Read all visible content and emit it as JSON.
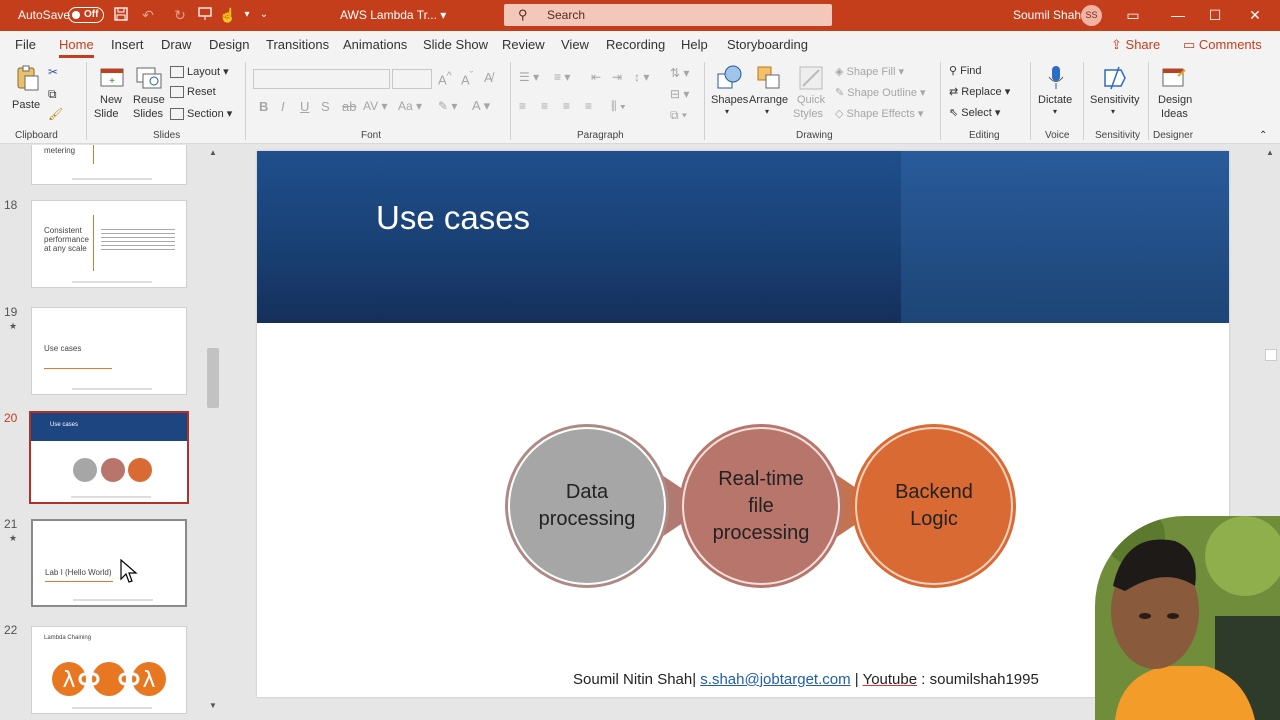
{
  "titlebar": {
    "autosave_label": "AutoSave",
    "autosave_state": "Off",
    "doc_title": "AWS Lambda Tr...",
    "search_placeholder": "Search",
    "user_name": "Soumil Shah",
    "user_initials": "SS"
  },
  "menu": {
    "tabs": [
      "File",
      "Home",
      "Insert",
      "Draw",
      "Design",
      "Transitions",
      "Animations",
      "Slide Show",
      "Review",
      "View",
      "Recording",
      "Help",
      "Storyboarding"
    ],
    "active": "Home",
    "share": "Share",
    "comments": "Comments"
  },
  "ribbon": {
    "clipboard": {
      "paste": "Paste",
      "group": "Clipboard"
    },
    "slides": {
      "new_slide_1": "New",
      "new_slide_2": "Slide",
      "reuse_1": "Reuse",
      "reuse_2": "Slides",
      "layout": "Layout",
      "reset": "Reset",
      "section": "Section",
      "group": "Slides"
    },
    "font": {
      "group": "Font"
    },
    "paragraph": {
      "group": "Paragraph"
    },
    "drawing": {
      "shapes": "Shapes",
      "arrange": "Arrange",
      "quick_styles_1": "Quick",
      "quick_styles_2": "Styles",
      "shape_fill": "Shape Fill",
      "shape_outline": "Shape Outline",
      "shape_effects": "Shape Effects",
      "group": "Drawing"
    },
    "editing": {
      "find": "Find",
      "replace": "Replace",
      "select": "Select",
      "group": "Editing"
    },
    "voice": {
      "dictate": "Dictate",
      "group": "Voice"
    },
    "sensitivity": {
      "label": "Sensitivity",
      "group": "Sensitivity"
    },
    "designer": {
      "label_1": "Design",
      "label_2": "Ideas",
      "group": "Designer"
    }
  },
  "thumbnails": [
    {
      "num": "",
      "title": "metering",
      "star": false
    },
    {
      "num": "18",
      "title": "Consistent performance at any scale",
      "star": false
    },
    {
      "num": "19",
      "title": "Use cases",
      "star": true
    },
    {
      "num": "20",
      "title": "Use cases",
      "star": false,
      "selected": true
    },
    {
      "num": "21",
      "title": "Lab I (Hello World)",
      "star": true
    },
    {
      "num": "22",
      "title": "Lambda Chaining",
      "star": false
    }
  ],
  "slide": {
    "title": "Use cases",
    "steps": [
      {
        "line1": "Data",
        "line2": "processing",
        "line3": "",
        "color": "#a6a6a6"
      },
      {
        "line1": "Real-time",
        "line2": "file",
        "line3": "processing",
        "color": "#b8756b"
      },
      {
        "line1": "Backend",
        "line2": "Logic",
        "line3": "",
        "color": "#d96a34"
      }
    ],
    "footer": {
      "name": "Soumil Nitin Shah|",
      "email": "s.shah@jobtarget.com",
      "sep": " | ",
      "youtube": "Youtube",
      "channel": " : soumilshah1995"
    }
  },
  "colors": {
    "accent": "#c43e1c",
    "header_blue": "#1f4f8c"
  }
}
